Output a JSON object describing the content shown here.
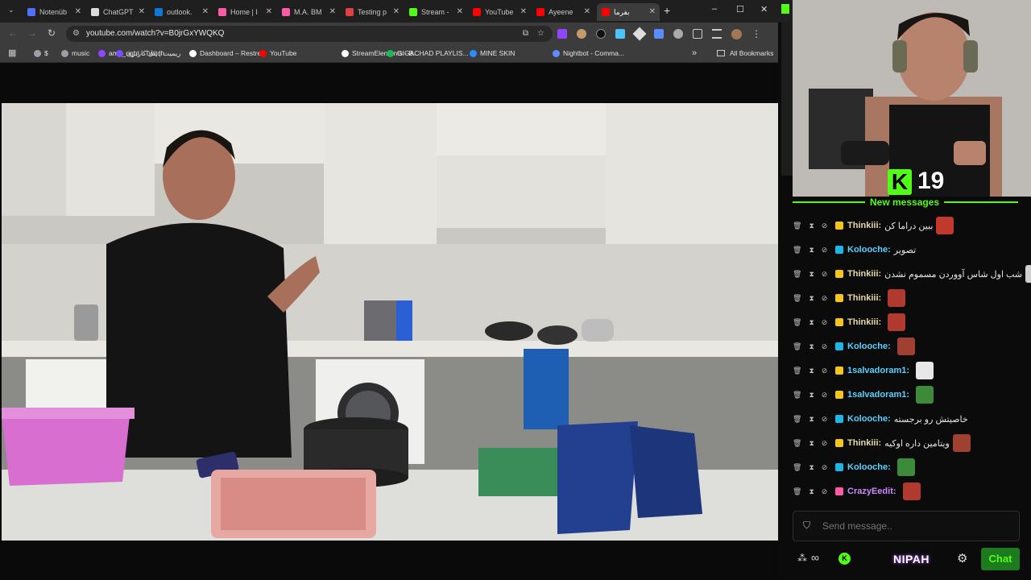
{
  "tabs": [
    {
      "label": "Notenüb",
      "color": "#4f6fff"
    },
    {
      "label": "ChatGPT",
      "color": "#dcdcdc"
    },
    {
      "label": "outlook.",
      "color": "#0f78d4"
    },
    {
      "label": "Home | I",
      "color": "#ff5aa5"
    },
    {
      "label": "M.A. BM",
      "color": "#ff5aa5"
    },
    {
      "label": "Testing p",
      "color": "#e04040"
    },
    {
      "label": "Stream -",
      "color": "#53fc18"
    },
    {
      "label": "YouTube",
      "color": "#ff0000"
    },
    {
      "label": "Ayeene",
      "color": "#ff0000"
    },
    {
      "label": "بفرما",
      "color": "#ff0000"
    }
  ],
  "new_tab": "+",
  "window_controls": {
    "minimize": "–",
    "maximize": "☐",
    "close": "✕"
  },
  "url": "youtube.com/watch?v=B0jrGxYWQKQ",
  "bookmarks": [
    {
      "label": "$",
      "color": "#9aa0a6"
    },
    {
      "label": "music",
      "color": "#9aa0a6"
    },
    {
      "label": "amir_right - Twitch",
      "color": "#9146ff"
    },
    {
      "label": "ریمیت | پنل کاربری",
      "color": "#7c4dff"
    },
    {
      "label": "Dashboard – Restre...",
      "color": "#ffffff"
    },
    {
      "label": "YouTube",
      "color": "#ff0000"
    },
    {
      "label": "StreamElements - B...",
      "color": "#ffffff"
    },
    {
      "label": "GIGACHAD PLAYLIS...",
      "color": "#1db954"
    },
    {
      "label": "MINE SKIN",
      "color": "#2b8cff"
    },
    {
      "label": "Nightbot - Comma...",
      "color": "#5b8cff"
    }
  ],
  "bookmarks_more": "»",
  "all_bookmarks": "All Bookmarks",
  "overlay": {
    "kick_logo": "K",
    "viewer_count": "19",
    "new_messages": "New messages"
  },
  "chat_messages": [
    {
      "user": "Thinkiii:",
      "user_color": "#e8d9a8",
      "badge_color": "#f5c518",
      "text": "ببین دراما کن",
      "emote": true
    },
    {
      "user": "Kolooche:",
      "user_color": "#5ad2ff",
      "badge_color": "#18b8e8",
      "text": "تصویر",
      "emote": false
    },
    {
      "user": "Thinkiii:",
      "user_color": "#e8d9a8",
      "badge_color": "#f5c518",
      "text": "شب اول شاس آووردن مسموم نشدن",
      "emote": true
    },
    {
      "user": "Thinkiii:",
      "user_color": "#e8d9a8",
      "badge_color": "#f5c518",
      "text": "",
      "emote": true
    },
    {
      "user": "Thinkiii:",
      "user_color": "#e8d9a8",
      "badge_color": "#f5c518",
      "text": "",
      "emote": true
    },
    {
      "user": "Kolooche:",
      "user_color": "#5ad2ff",
      "badge_color": "#18b8e8",
      "text": "",
      "emote": true
    },
    {
      "user": "1salvadoram1:",
      "user_color": "#5ad2ff",
      "badge_color": "#f5c518",
      "text": "",
      "emote": true
    },
    {
      "user": "1salvadoram1:",
      "user_color": "#5ad2ff",
      "badge_color": "#f5c518",
      "text": "",
      "emote": true
    },
    {
      "user": "Kolooche:",
      "user_color": "#5ad2ff",
      "badge_color": "#18b8e8",
      "text": "خاصیتش رو برجسته",
      "emote": false
    },
    {
      "user": "Thinkiii:",
      "user_color": "#e8d9a8",
      "badge_color": "#f5c518",
      "text": "ویتامین داره اوکیه",
      "emote": true
    },
    {
      "user": "Kolooche:",
      "user_color": "#5ad2ff",
      "badge_color": "#18b8e8",
      "text": "",
      "emote": true
    },
    {
      "user": "CrazyEedit:",
      "user_color": "#c98bff",
      "badge_color": "#ff5aa5",
      "text": "",
      "emote": true
    }
  ],
  "chat_input": {
    "placeholder": "Send message.."
  },
  "chat_footer": {
    "brand": "NIPAH",
    "chat_button": "Chat",
    "infinity": "∞"
  },
  "colors": {
    "kick_green": "#53fc18",
    "chat_button_bg": "#1e7a1e"
  }
}
